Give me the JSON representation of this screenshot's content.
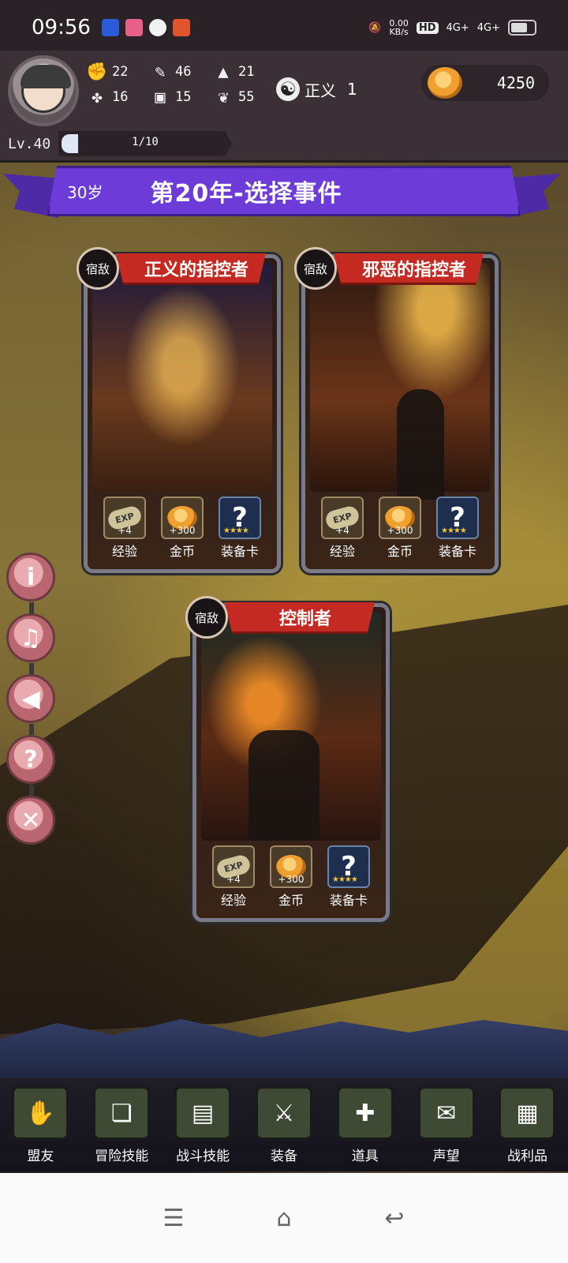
{
  "status_bar": {
    "time": "09:56",
    "net_speed": "0.00\nKB/s",
    "net_speed_top": "0.00",
    "net_speed_bottom": "KB/s",
    "hd": "HD",
    "sim1": "4G+",
    "sim2": "4G+"
  },
  "hud": {
    "stats": [
      {
        "icon": "fist-icon",
        "glyph": "✊",
        "value": "22"
      },
      {
        "icon": "scroll-icon",
        "glyph": "✎",
        "value": "46"
      },
      {
        "icon": "hat-icon",
        "glyph": "▲",
        "value": "21"
      },
      {
        "icon": "clover-icon",
        "glyph": "✤",
        "value": "16"
      },
      {
        "icon": "armor-icon",
        "glyph": "▣",
        "value": "15"
      },
      {
        "icon": "wings-icon",
        "glyph": "❦",
        "value": "55"
      }
    ],
    "alignment_label": "正义",
    "alignment_value": "1",
    "alignment_symbol": "☯",
    "coins": "4250",
    "level": "Lv.40",
    "xp_text": "1/10",
    "xp_fraction": 0.1
  },
  "banner": {
    "age": "30岁",
    "title": "第20年-选择事件"
  },
  "cards": [
    {
      "tag": "宿敌",
      "title": "正义的指控者",
      "rewards": [
        {
          "kind": "exp",
          "badge": "EXP",
          "amount": "+4",
          "label": "经验"
        },
        {
          "kind": "gold",
          "amount": "+300",
          "label": "金币"
        },
        {
          "kind": "card",
          "badge": "?",
          "stars": "★★★★",
          "label": "装备卡"
        }
      ]
    },
    {
      "tag": "宿敌",
      "title": "邪恶的指控者",
      "rewards": [
        {
          "kind": "exp",
          "badge": "EXP",
          "amount": "+4",
          "label": "经验"
        },
        {
          "kind": "gold",
          "amount": "+300",
          "label": "金币"
        },
        {
          "kind": "card",
          "badge": "?",
          "stars": "★★★★",
          "label": "装备卡"
        }
      ]
    },
    {
      "tag": "宿敌",
      "title": "控制者",
      "rewards": [
        {
          "kind": "exp",
          "badge": "EXP",
          "amount": "+4",
          "label": "经验"
        },
        {
          "kind": "gold",
          "amount": "+300",
          "label": "金币"
        },
        {
          "kind": "card",
          "badge": "?",
          "stars": "★★★★",
          "label": "装备卡"
        }
      ]
    }
  ],
  "side_buttons": [
    {
      "name": "info-button",
      "icon": "info-icon",
      "glyph": "i"
    },
    {
      "name": "music-toggle-button",
      "icon": "music-off-icon",
      "glyph": "♫"
    },
    {
      "name": "sound-button",
      "icon": "speaker-icon",
      "glyph": "◀"
    },
    {
      "name": "help-button",
      "icon": "question-icon",
      "glyph": "?"
    },
    {
      "name": "close-button",
      "icon": "close-icon",
      "glyph": "✕"
    }
  ],
  "menu": [
    {
      "label": "盟友",
      "icon": "gauntlet-icon",
      "glyph": "✋"
    },
    {
      "label": "冒险技能",
      "icon": "book-icon",
      "glyph": "❏"
    },
    {
      "label": "战斗技能",
      "icon": "backpack-icon",
      "glyph": "▤"
    },
    {
      "label": "装备",
      "icon": "swords-icon",
      "glyph": "⚔"
    },
    {
      "label": "道具",
      "icon": "amulet-icon",
      "glyph": "✚"
    },
    {
      "label": "声望",
      "icon": "scroll-icon",
      "glyph": "✉"
    },
    {
      "label": "战利品",
      "icon": "chest-icon",
      "glyph": "▦"
    }
  ],
  "navbar": [
    {
      "name": "menu-nav-button",
      "icon": "menu-icon",
      "glyph": "☰"
    },
    {
      "name": "home-nav-button",
      "icon": "home-icon",
      "glyph": "⌂"
    },
    {
      "name": "back-nav-button",
      "icon": "back-icon",
      "glyph": "↩"
    }
  ]
}
